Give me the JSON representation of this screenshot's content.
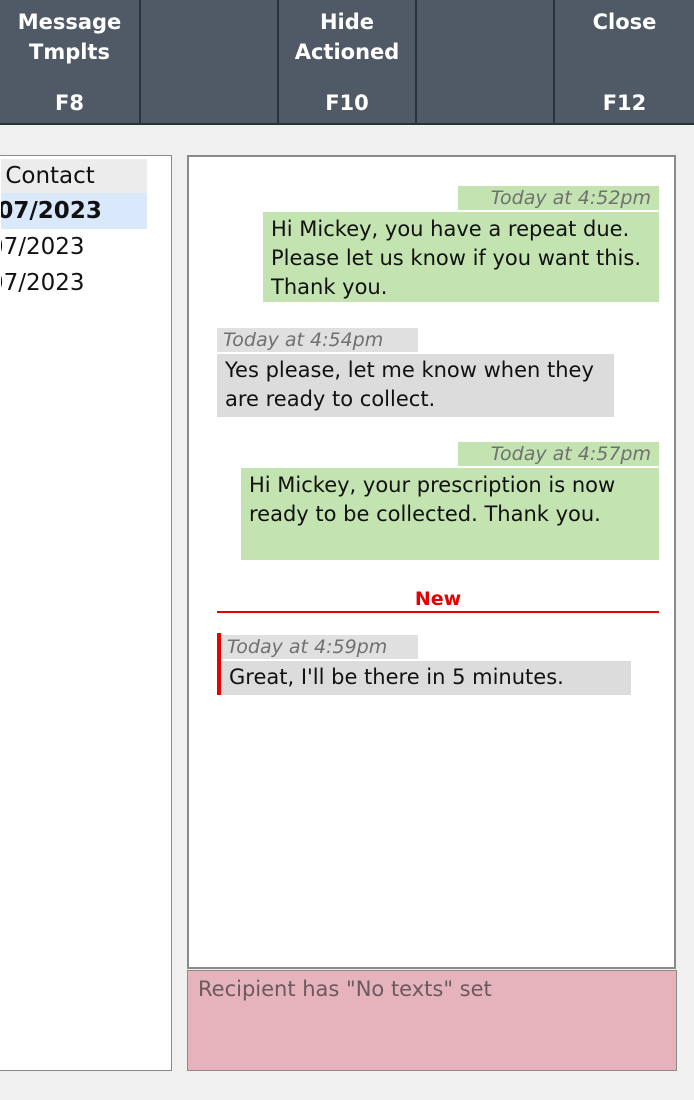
{
  "toolbar": {
    "buttons": [
      {
        "label": "Message\nTmplts",
        "key": "F8"
      },
      {
        "label": "",
        "key": ""
      },
      {
        "label": "Hide\nActioned",
        "key": "F10"
      },
      {
        "label": "",
        "key": ""
      },
      {
        "label": "Close",
        "key": "F12"
      }
    ]
  },
  "contacts": {
    "header": "t Contact",
    "rows": [
      {
        "date": "/07/2023",
        "selected": true
      },
      {
        "date": "07/2023",
        "selected": false
      },
      {
        "date": "07/2023",
        "selected": false
      }
    ]
  },
  "conversation": {
    "messages": [
      {
        "direction": "out",
        "time": "Today at 4:52pm",
        "text": "Hi Mickey, you have a repeat due. Please let us know if you want this. Thank you."
      },
      {
        "direction": "in",
        "time": "Today at 4:54pm",
        "text": "Yes please, let me know when they are ready to collect."
      },
      {
        "direction": "out",
        "time": "Today at 4:57pm",
        "text": "Hi Mickey, your prescription is now ready to be collected. Thank you."
      },
      {
        "direction": "in",
        "time": "Today at 4:59pm",
        "text": "Great, I'll be there in 5 minutes.",
        "is_new": true
      }
    ],
    "new_label": "New"
  },
  "notice": {
    "text": "Recipient has \"No texts\" set"
  },
  "colors": {
    "toolbar_bg": "#4f5a66",
    "outgoing_bubble": "#c3e4b1",
    "incoming_bubble": "#dcdcdc",
    "new_marker": "#e60000",
    "notice_bg": "#e6b3bd",
    "selected_row": "#d9e8fb"
  }
}
